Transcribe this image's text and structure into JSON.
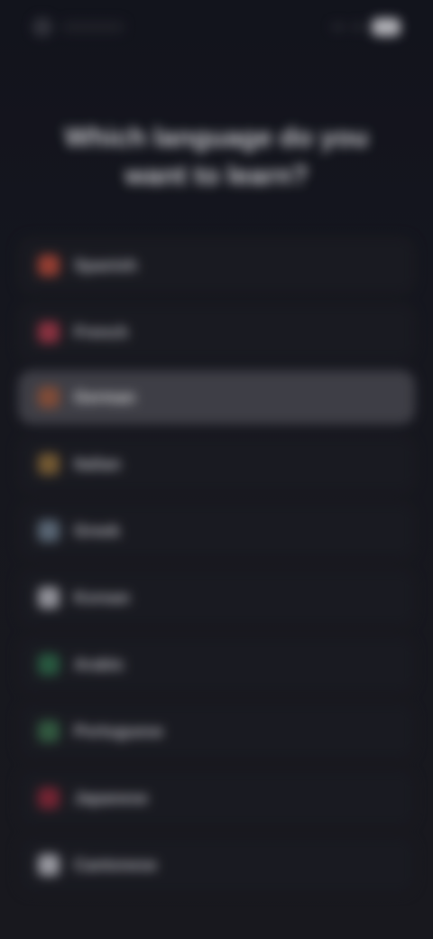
{
  "app": {
    "title": ""
  },
  "status_bar": {
    "time": "",
    "icons": [
      "logo-icon",
      "signal-icon",
      "battery-icon"
    ]
  },
  "header": {
    "title": "Which language do you want to learn?"
  },
  "languages": [
    {
      "name": "Spanish",
      "native": "",
      "icon": "flag-spain-icon",
      "color": "#b44a3a",
      "selected": false
    },
    {
      "name": "French",
      "native": "",
      "icon": "flag-france-icon",
      "color": "#a53a4a",
      "selected": false
    },
    {
      "name": "German",
      "native": "",
      "icon": "flag-germany-icon",
      "color": "#9a5a40",
      "selected": true
    },
    {
      "name": "Italian",
      "native": "",
      "icon": "flag-italy-icon",
      "color": "#8a6a3a",
      "selected": false
    },
    {
      "name": "Greek",
      "native": "",
      "icon": "flag-greece-icon",
      "color": "#6a7a8a",
      "selected": false
    },
    {
      "name": "Korean",
      "native": "",
      "icon": "flag-korea-icon",
      "color": "#b0b0b8",
      "selected": false
    },
    {
      "name": "Arabic",
      "native": "",
      "icon": "flag-saudi-icon",
      "color": "#2f6a4a",
      "selected": false
    },
    {
      "name": "Portuguese",
      "native": "",
      "icon": "flag-portugal-icon",
      "color": "#3a6a4a",
      "selected": false
    },
    {
      "name": "Japanese",
      "native": "",
      "icon": "flag-japan-icon",
      "color": "#8a2a3a",
      "selected": false
    },
    {
      "name": "Cantonese",
      "native": "",
      "icon": "flag-hongkong-icon",
      "color": "#b8b8c0",
      "selected": false
    }
  ],
  "colors": {
    "background": "#14161f",
    "row": "#1d1e25",
    "row_selected": "#4a4a52"
  }
}
